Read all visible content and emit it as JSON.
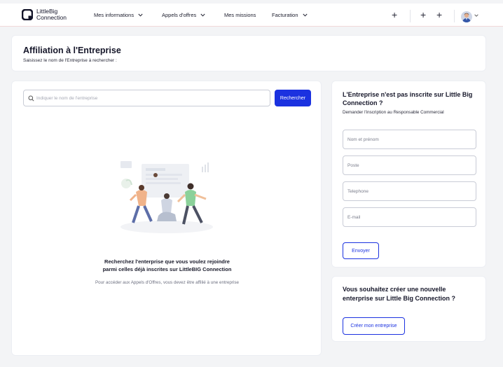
{
  "app": {
    "logo_line1": "LittleBig",
    "logo_line2": "Connection"
  },
  "nav": {
    "items": [
      {
        "label": "Mes informations",
        "has_dropdown": true
      },
      {
        "label": "Appels d'offres",
        "has_dropdown": true
      },
      {
        "label": "Mes missions",
        "has_dropdown": false
      },
      {
        "label": "Facturation",
        "has_dropdown": true
      }
    ],
    "plus_glyph": "+"
  },
  "header": {
    "title": "Affiliation à l'Entreprise",
    "subtitle": "Saisissez le nom de l'Entreprise à rechercher :"
  },
  "search": {
    "placeholder": "Indiquer le nom de l'entreprise",
    "value": "",
    "button_label": "Rechercher"
  },
  "empty_state": {
    "title_line1": "Recherchez l'enterprise que vous voulez rejoindre",
    "title_line2": "parmi celles déjà inscrites sur LittleBIG Connection",
    "subtitle": "Pour accéder aux Appels d'Offres, vous devez être affilié à une entreprise"
  },
  "request_form": {
    "title_line1": "L'Entreprise n'est pas inscrite sur Little Big",
    "title_line2": "Connection ?",
    "subtitle": "Demander l'inscription au Responsable Commercial",
    "fields": [
      {
        "placeholder": "Nom et prénom",
        "value": ""
      },
      {
        "placeholder": "Poste",
        "value": ""
      },
      {
        "placeholder": "Telephone",
        "value": ""
      },
      {
        "placeholder": "E-mail",
        "value": ""
      }
    ],
    "submit_label": "Envoyer"
  },
  "create_company": {
    "title_line1": "Vous souhaitez créer une nouvelle",
    "title_line2": "enterprise sur Little Big Connection ?",
    "button_label": "Créer mon entreprise"
  },
  "colors": {
    "primary": "#1b32e0",
    "page_bg": "#f3f4f6",
    "card_bg": "#ffffff",
    "text_dark": "#16172a"
  },
  "icons": [
    "logo-icon",
    "chevron-down-icon",
    "plus-icon",
    "search-icon",
    "avatar",
    "illustration"
  ]
}
